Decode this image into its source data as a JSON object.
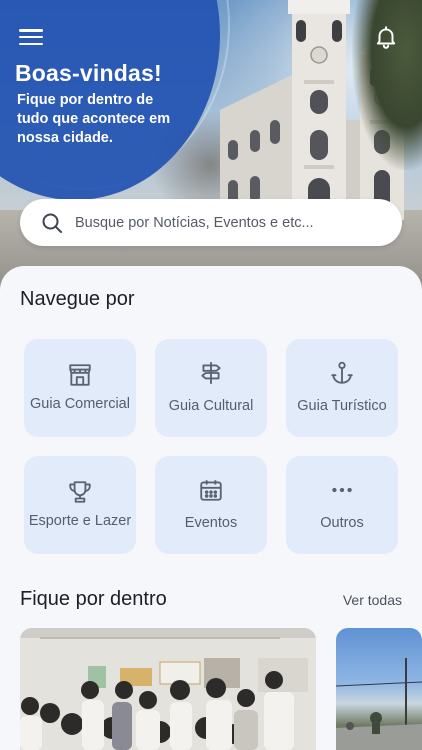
{
  "header": {
    "menu_icon": "hamburger-menu-icon",
    "notification_icon": "bell-icon",
    "title": "Boas-vindas!",
    "subtitle": "Fique por dentro de tudo que acontece em nossa cidade."
  },
  "search": {
    "placeholder": "Busque por Notícias, Eventos e etc...",
    "icon": "search-icon"
  },
  "navigate": {
    "title": "Navegue por",
    "items": [
      {
        "label": "Guia Comercial",
        "icon": "storefront-icon"
      },
      {
        "label": "Guia Cultural",
        "icon": "signpost-icon"
      },
      {
        "label": "Guia Turístico",
        "icon": "anchor-icon"
      },
      {
        "label": "Esporte e Lazer",
        "icon": "trophy-icon"
      },
      {
        "label": "Eventos",
        "icon": "calendar-icon"
      },
      {
        "label": "Outros",
        "icon": "more-dots-icon"
      }
    ]
  },
  "news": {
    "title": "Fique por dentro",
    "see_all_label": "Ver todas",
    "cards": [
      {
        "image": "classroom-students-photo"
      },
      {
        "image": "road-landscape-photo"
      }
    ]
  },
  "colors": {
    "hero_blue": "#2252b2",
    "tile_bg": "#e2ebfa",
    "icon_color": "#5a6170"
  }
}
